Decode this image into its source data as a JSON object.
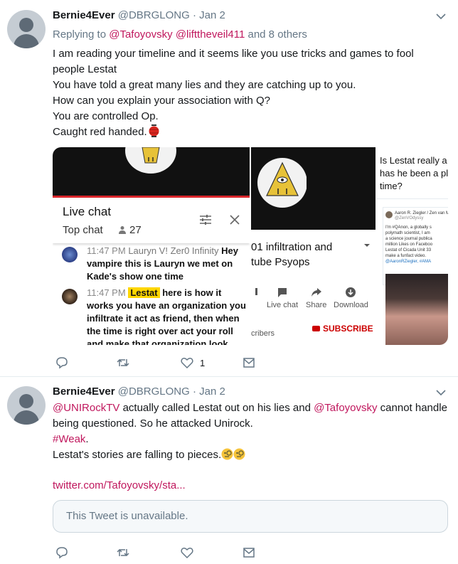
{
  "tweets": [
    {
      "author_name": "Bernie4Ever",
      "author_handle": "@DBRGLONG",
      "dot": "·",
      "time": "Jan 2",
      "reply_prefix": "Replying to",
      "reply_mentions": [
        "@Tafoyovsky",
        "@lifttheveil411"
      ],
      "reply_and": "and 8 others",
      "lines": [
        "I am reading your timeline and it seems like you use tricks and games to fool",
        "people Lestat",
        "You have told a great many lies and they are catching up to you.",
        "How can you explain your association with Q?",
        "You are controlled Op.",
        "Caught red handed."
      ],
      "actions": {
        "reply": "",
        "retweet": "",
        "like": "1",
        "dm": ""
      },
      "media": {
        "image1": {
          "live_chat_title": "Live chat",
          "top_chat": "Top chat",
          "viewers": "27",
          "messages": [
            {
              "time": "11:47 PM",
              "user": "Lauryn V! Zer0 Infinity",
              "text": "Hey vampire this is Lauryn we met on Kade's show one time"
            },
            {
              "time": "11:47 PM",
              "user": "Lestat",
              "text": "here is how it works you have an organization you infiltrate it act as friend, then when the time is right over act your roll and make that organization look"
            }
          ]
        },
        "image2": {
          "title_line1": "01  infiltration and",
          "title_line2": "tube Psyops",
          "action_live_chat": "Live chat",
          "action_share": "Share",
          "action_download": "Download",
          "subscribers": "cribers",
          "subscribe": "SUBSCRIBE"
        },
        "image3": {
          "question_lines": [
            "Is Lestat really a",
            "has he been a pl",
            "time?"
          ],
          "card_author": "Aaron R. Ziegler / Zen van M",
          "card_handle": "@ZenVOdyssy",
          "card_lines": [
            "I'm #QAnon, a globally s",
            "polymath scientist, I am",
            "a science journal publica",
            "million Likes on Faceboo",
            "Lestat of Cicada Unit 33",
            "make a funfact video. ",
            "@AaronRZiegler, #AMA"
          ]
        }
      }
    },
    {
      "author_name": "Bernie4Ever",
      "author_handle": "@DBRGLONG",
      "dot": "·",
      "time": "Jan 2",
      "line1_mention": "@UNIRockTV",
      "line1_text": " actually called Lestat out on his lies and ",
      "line1_mention2": "@Tafoyovsky",
      "line1_end": " cannot handle",
      "line2": "being questioned. So he attacked Unirock.",
      "hashtag": "#Weak",
      "hashtag_end": ".",
      "line4": "Lestat's stories are falling to pieces.",
      "link": "twitter.com/Tafoyovsky/sta...",
      "quote_unavailable": "This Tweet is unavailable.",
      "actions": {
        "reply": "",
        "retweet": "",
        "like": "",
        "dm": ""
      }
    }
  ],
  "colors": {
    "mention": "#c0175d",
    "secondary": "#657786",
    "border": "#e6ecf0"
  },
  "icons": [
    "caret-down-icon",
    "reply-icon",
    "retweet-icon",
    "heart-icon",
    "envelope-icon",
    "lantern-icon",
    "monocle-emoji-icon"
  ]
}
